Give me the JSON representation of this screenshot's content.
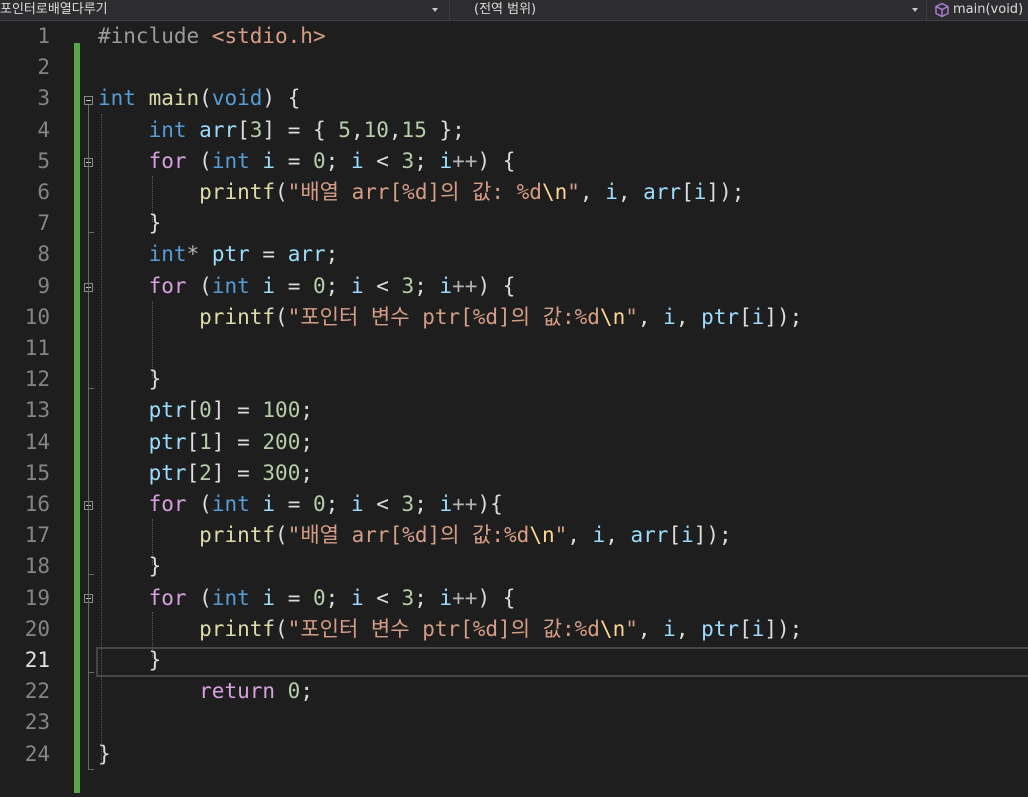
{
  "navbar": {
    "project": "포인터로배열다루기",
    "scope": "(전역 범위)",
    "member": "main(void)",
    "member_icon": "cube-icon"
  },
  "editor": {
    "current_line": 21,
    "colors": {
      "background": "#1e1e1e",
      "change_bar": "#57a64a",
      "keyword": "#569cd6",
      "control": "#d8a0df",
      "function": "#dcdcaa",
      "string": "#d69d85",
      "variable": "#9cdcfe",
      "number": "#b5cea8"
    },
    "lines": [
      {
        "n": "1",
        "tokens": [
          {
            "t": "pp",
            "s": "#include "
          },
          {
            "t": "str",
            "s": "<stdio.h>"
          }
        ]
      },
      {
        "n": "2",
        "tokens": []
      },
      {
        "n": "3",
        "tokens": [
          {
            "t": "kw",
            "s": "int"
          },
          {
            "t": "",
            "s": " "
          },
          {
            "t": "fn",
            "s": "main"
          },
          {
            "t": "",
            "s": "("
          },
          {
            "t": "kw",
            "s": "void"
          },
          {
            "t": "",
            "s": ") {"
          }
        ]
      },
      {
        "n": "4",
        "tokens": [
          {
            "t": "",
            "s": "    "
          },
          {
            "t": "kw",
            "s": "int"
          },
          {
            "t": "",
            "s": " "
          },
          {
            "t": "var",
            "s": "arr"
          },
          {
            "t": "",
            "s": "["
          },
          {
            "t": "num",
            "s": "3"
          },
          {
            "t": "",
            "s": "] = { "
          },
          {
            "t": "num",
            "s": "5"
          },
          {
            "t": "",
            "s": ","
          },
          {
            "t": "num",
            "s": "10"
          },
          {
            "t": "",
            "s": ","
          },
          {
            "t": "num",
            "s": "15"
          },
          {
            "t": "",
            "s": " };"
          }
        ]
      },
      {
        "n": "5",
        "tokens": [
          {
            "t": "",
            "s": "    "
          },
          {
            "t": "ctl",
            "s": "for"
          },
          {
            "t": "",
            "s": " ("
          },
          {
            "t": "kw",
            "s": "int"
          },
          {
            "t": "",
            "s": " "
          },
          {
            "t": "var",
            "s": "i"
          },
          {
            "t": "",
            "s": " = "
          },
          {
            "t": "num",
            "s": "0"
          },
          {
            "t": "",
            "s": "; "
          },
          {
            "t": "var",
            "s": "i"
          },
          {
            "t": "",
            "s": " < "
          },
          {
            "t": "num",
            "s": "3"
          },
          {
            "t": "",
            "s": "; "
          },
          {
            "t": "var",
            "s": "i"
          },
          {
            "t": "op",
            "s": "++"
          },
          {
            "t": "",
            "s": ") {"
          }
        ]
      },
      {
        "n": "6",
        "tokens": [
          {
            "t": "",
            "s": "        "
          },
          {
            "t": "fn",
            "s": "printf"
          },
          {
            "t": "",
            "s": "("
          },
          {
            "t": "str",
            "s": "\"배열 arr[%d]의 값: %d"
          },
          {
            "t": "esc",
            "s": "\\n"
          },
          {
            "t": "str",
            "s": "\""
          },
          {
            "t": "",
            "s": ", "
          },
          {
            "t": "var",
            "s": "i"
          },
          {
            "t": "",
            "s": ", "
          },
          {
            "t": "var",
            "s": "arr"
          },
          {
            "t": "",
            "s": "["
          },
          {
            "t": "var",
            "s": "i"
          },
          {
            "t": "",
            "s": "]);"
          }
        ]
      },
      {
        "n": "7",
        "tokens": [
          {
            "t": "",
            "s": "    }"
          }
        ]
      },
      {
        "n": "8",
        "tokens": [
          {
            "t": "",
            "s": "    "
          },
          {
            "t": "kw",
            "s": "int"
          },
          {
            "t": "op",
            "s": "*"
          },
          {
            "t": "",
            "s": " "
          },
          {
            "t": "var",
            "s": "ptr"
          },
          {
            "t": "",
            "s": " = "
          },
          {
            "t": "var",
            "s": "arr"
          },
          {
            "t": "",
            "s": ";"
          }
        ]
      },
      {
        "n": "9",
        "tokens": [
          {
            "t": "",
            "s": "    "
          },
          {
            "t": "ctl",
            "s": "for"
          },
          {
            "t": "",
            "s": " ("
          },
          {
            "t": "kw",
            "s": "int"
          },
          {
            "t": "",
            "s": " "
          },
          {
            "t": "var",
            "s": "i"
          },
          {
            "t": "",
            "s": " = "
          },
          {
            "t": "num",
            "s": "0"
          },
          {
            "t": "",
            "s": "; "
          },
          {
            "t": "var",
            "s": "i"
          },
          {
            "t": "",
            "s": " < "
          },
          {
            "t": "num",
            "s": "3"
          },
          {
            "t": "",
            "s": "; "
          },
          {
            "t": "var",
            "s": "i"
          },
          {
            "t": "op",
            "s": "++"
          },
          {
            "t": "",
            "s": ") {"
          }
        ]
      },
      {
        "n": "10",
        "tokens": [
          {
            "t": "",
            "s": "        "
          },
          {
            "t": "fn",
            "s": "printf"
          },
          {
            "t": "",
            "s": "("
          },
          {
            "t": "str",
            "s": "\"포인터 변수 ptr[%d]의 값:%d"
          },
          {
            "t": "esc",
            "s": "\\n"
          },
          {
            "t": "str",
            "s": "\""
          },
          {
            "t": "",
            "s": ", "
          },
          {
            "t": "var",
            "s": "i"
          },
          {
            "t": "",
            "s": ", "
          },
          {
            "t": "var",
            "s": "ptr"
          },
          {
            "t": "",
            "s": "["
          },
          {
            "t": "var",
            "s": "i"
          },
          {
            "t": "",
            "s": "]);"
          }
        ]
      },
      {
        "n": "11",
        "tokens": []
      },
      {
        "n": "12",
        "tokens": [
          {
            "t": "",
            "s": "    }"
          }
        ]
      },
      {
        "n": "13",
        "tokens": [
          {
            "t": "",
            "s": "    "
          },
          {
            "t": "var",
            "s": "ptr"
          },
          {
            "t": "",
            "s": "["
          },
          {
            "t": "num",
            "s": "0"
          },
          {
            "t": "",
            "s": "] = "
          },
          {
            "t": "num",
            "s": "100"
          },
          {
            "t": "",
            "s": ";"
          }
        ]
      },
      {
        "n": "14",
        "tokens": [
          {
            "t": "",
            "s": "    "
          },
          {
            "t": "var",
            "s": "ptr"
          },
          {
            "t": "",
            "s": "["
          },
          {
            "t": "num",
            "s": "1"
          },
          {
            "t": "",
            "s": "] = "
          },
          {
            "t": "num",
            "s": "200"
          },
          {
            "t": "",
            "s": ";"
          }
        ]
      },
      {
        "n": "15",
        "tokens": [
          {
            "t": "",
            "s": "    "
          },
          {
            "t": "var",
            "s": "ptr"
          },
          {
            "t": "",
            "s": "["
          },
          {
            "t": "num",
            "s": "2"
          },
          {
            "t": "",
            "s": "] = "
          },
          {
            "t": "num",
            "s": "300"
          },
          {
            "t": "",
            "s": ";"
          }
        ]
      },
      {
        "n": "16",
        "tokens": [
          {
            "t": "",
            "s": "    "
          },
          {
            "t": "ctl",
            "s": "for"
          },
          {
            "t": "",
            "s": " ("
          },
          {
            "t": "kw",
            "s": "int"
          },
          {
            "t": "",
            "s": " "
          },
          {
            "t": "var",
            "s": "i"
          },
          {
            "t": "",
            "s": " = "
          },
          {
            "t": "num",
            "s": "0"
          },
          {
            "t": "",
            "s": "; "
          },
          {
            "t": "var",
            "s": "i"
          },
          {
            "t": "",
            "s": " < "
          },
          {
            "t": "num",
            "s": "3"
          },
          {
            "t": "",
            "s": "; "
          },
          {
            "t": "var",
            "s": "i"
          },
          {
            "t": "op",
            "s": "++"
          },
          {
            "t": "",
            "s": "){"
          }
        ]
      },
      {
        "n": "17",
        "tokens": [
          {
            "t": "",
            "s": "        "
          },
          {
            "t": "fn",
            "s": "printf"
          },
          {
            "t": "",
            "s": "("
          },
          {
            "t": "str",
            "s": "\"배열 arr[%d]의 값:%d"
          },
          {
            "t": "esc",
            "s": "\\n"
          },
          {
            "t": "str",
            "s": "\""
          },
          {
            "t": "",
            "s": ", "
          },
          {
            "t": "var",
            "s": "i"
          },
          {
            "t": "",
            "s": ", "
          },
          {
            "t": "var",
            "s": "arr"
          },
          {
            "t": "",
            "s": "["
          },
          {
            "t": "var",
            "s": "i"
          },
          {
            "t": "",
            "s": "]);"
          }
        ]
      },
      {
        "n": "18",
        "tokens": [
          {
            "t": "",
            "s": "    }"
          }
        ]
      },
      {
        "n": "19",
        "tokens": [
          {
            "t": "",
            "s": "    "
          },
          {
            "t": "ctl",
            "s": "for"
          },
          {
            "t": "",
            "s": " ("
          },
          {
            "t": "kw",
            "s": "int"
          },
          {
            "t": "",
            "s": " "
          },
          {
            "t": "var",
            "s": "i"
          },
          {
            "t": "",
            "s": " = "
          },
          {
            "t": "num",
            "s": "0"
          },
          {
            "t": "",
            "s": "; "
          },
          {
            "t": "var",
            "s": "i"
          },
          {
            "t": "",
            "s": " < "
          },
          {
            "t": "num",
            "s": "3"
          },
          {
            "t": "",
            "s": "; "
          },
          {
            "t": "var",
            "s": "i"
          },
          {
            "t": "op",
            "s": "++"
          },
          {
            "t": "",
            "s": ") {"
          }
        ]
      },
      {
        "n": "20",
        "tokens": [
          {
            "t": "",
            "s": "        "
          },
          {
            "t": "fn",
            "s": "printf"
          },
          {
            "t": "",
            "s": "("
          },
          {
            "t": "str",
            "s": "\"포인터 변수 ptr[%d]의 값:%d"
          },
          {
            "t": "esc",
            "s": "\\n"
          },
          {
            "t": "str",
            "s": "\""
          },
          {
            "t": "",
            "s": ", "
          },
          {
            "t": "var",
            "s": "i"
          },
          {
            "t": "",
            "s": ", "
          },
          {
            "t": "var",
            "s": "ptr"
          },
          {
            "t": "",
            "s": "["
          },
          {
            "t": "var",
            "s": "i"
          },
          {
            "t": "",
            "s": "]);"
          }
        ]
      },
      {
        "n": "21",
        "tokens": [
          {
            "t": "",
            "s": "    }"
          }
        ]
      },
      {
        "n": "22",
        "tokens": [
          {
            "t": "",
            "s": "        "
          },
          {
            "t": "ctl",
            "s": "return"
          },
          {
            "t": "",
            "s": " "
          },
          {
            "t": "num",
            "s": "0"
          },
          {
            "t": "",
            "s": ";"
          }
        ]
      },
      {
        "n": "23",
        "tokens": []
      },
      {
        "n": "24",
        "tokens": [
          {
            "t": "",
            "s": "}"
          }
        ]
      }
    ]
  }
}
